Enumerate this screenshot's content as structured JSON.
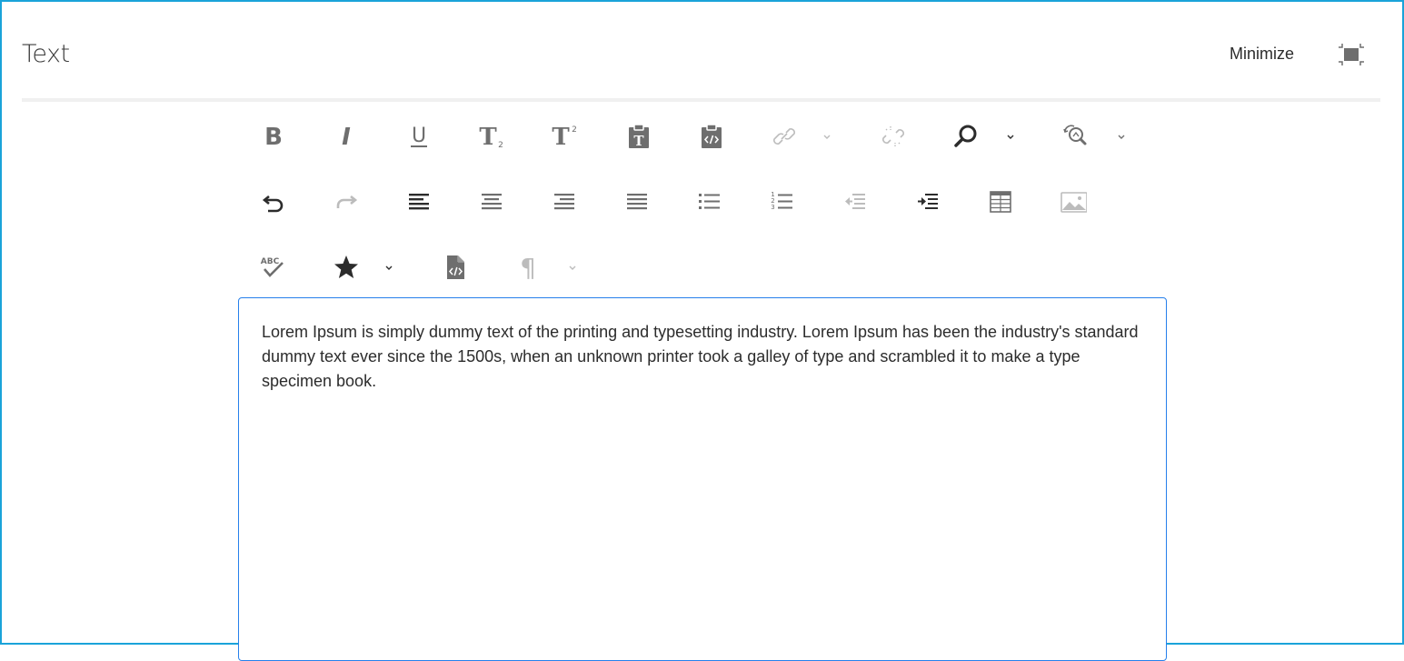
{
  "panel": {
    "title": "Text",
    "minimize_label": "Minimize",
    "fullscreen_icon": "fullscreen-exit-icon"
  },
  "toolbar": {
    "row1": [
      "bold-icon",
      "italic-icon",
      "underline-icon",
      "subscript-icon",
      "superscript-icon",
      "paste-as-text-icon",
      "paste-wordhtml-icon",
      "link-icon",
      "unlink-icon",
      "find-icon",
      "find-replace-icon"
    ],
    "row2": [
      "undo-icon",
      "redo-icon",
      "align-left-icon",
      "align-center-icon",
      "align-right-icon",
      "align-justify-icon",
      "bulleted-list-icon",
      "numbered-list-icon",
      "outdent-icon",
      "indent-icon",
      "table-icon",
      "image-icon"
    ],
    "row3": [
      "spellcheck-icon",
      "special-chars-icon",
      "source-edit-icon",
      "paragraph-format-icon"
    ],
    "glyphs": {
      "bold": "B",
      "italic": "I",
      "underline": "U",
      "subscript_base": "T",
      "subscript_mark": "2",
      "superscript_base": "T",
      "superscript_mark": "2",
      "paste_text": "T",
      "spellcheck": "ABC",
      "paragraph": "¶",
      "list_numbers": [
        "1",
        "2",
        "3"
      ]
    }
  },
  "editor": {
    "content": "Lorem Ipsum is simply dummy text of the printing and typesetting industry. Lorem Ipsum has been the industry's standard dummy text ever since the 1500s, when an unknown printer took a galley of type and scrambled it to make a type specimen book."
  },
  "colors": {
    "frame_border": "#1aa3d9",
    "editor_border": "#2680eb",
    "icon_active": "#6e6e6e",
    "icon_dark": "#2c2c2c",
    "icon_disabled": "#bcbcbc"
  }
}
